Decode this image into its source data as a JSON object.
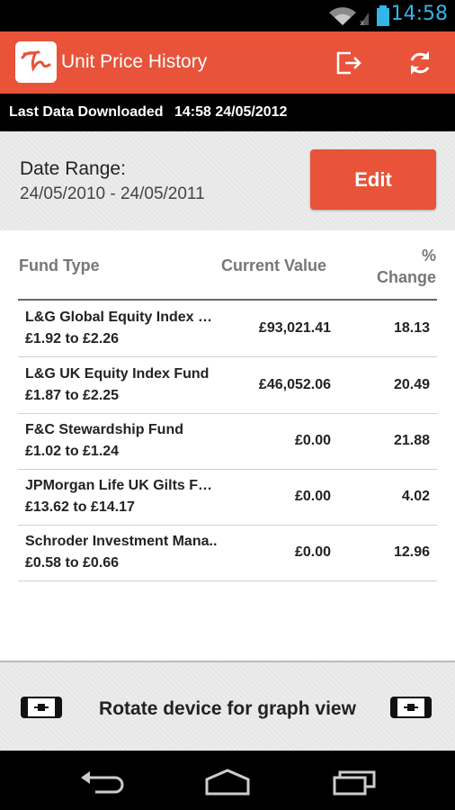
{
  "status_bar": {
    "time": "14:58",
    "icons": [
      "wifi-icon",
      "signal-icon",
      "battery-icon"
    ]
  },
  "action_bar": {
    "title": "Unit Price History",
    "logo_icon": "app-logo-icon",
    "actions": [
      "logout-icon",
      "refresh-icon"
    ],
    "color": "#e8533a"
  },
  "last_download": {
    "label": "Last Data Downloaded",
    "value": "14:58 24/05/2012"
  },
  "date_range": {
    "label": "Date Range:",
    "value": "24/05/2010 - 24/05/2011",
    "edit_label": "Edit"
  },
  "table": {
    "headers": {
      "fund_type": "Fund Type",
      "current_value": "Current Value",
      "change_line1": "%",
      "change_line2": "Change"
    },
    "rows": [
      {
        "name": "L&G Global Equity Index Fu..",
        "range": "£1.92 to £2.26",
        "current": "£93,021.41",
        "change": "18.13"
      },
      {
        "name": "L&G UK Equity Index Fund",
        "range": "£1.87 to £2.25",
        "current": "£46,052.06",
        "change": "20.49"
      },
      {
        "name": "F&C Stewardship Fund",
        "range": "£1.02 to £1.24",
        "current": "£0.00",
        "change": "21.88"
      },
      {
        "name": "JPMorgan Life UK Gilts Fun..",
        "range": "£13.62 to £14.17",
        "current": "£0.00",
        "change": "4.02"
      },
      {
        "name": "Schroder Investment Mana..",
        "range": "£0.58 to £0.66",
        "current": "£0.00",
        "change": "12.96"
      }
    ]
  },
  "rotate_hint": {
    "text": "Rotate device for graph view",
    "icons": [
      "rotate-device-icon",
      "rotate-device-icon"
    ]
  },
  "nav_bar": {
    "buttons": [
      "back-icon",
      "home-icon",
      "recent-apps-icon"
    ]
  }
}
